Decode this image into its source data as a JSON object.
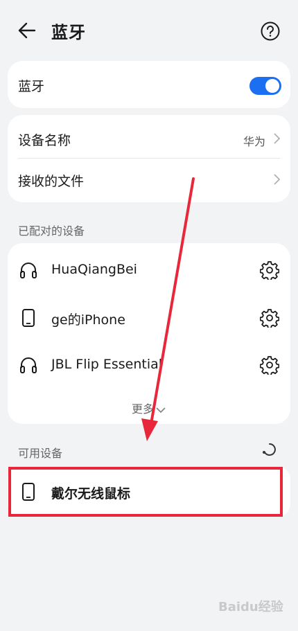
{
  "header": {
    "title": "蓝牙"
  },
  "bluetooth": {
    "label": "蓝牙",
    "enabled": true
  },
  "settings": {
    "device_name_label": "设备名称",
    "device_name_value": "华为",
    "received_files_label": "接收的文件"
  },
  "paired": {
    "section_label": "已配对的设备",
    "devices": [
      {
        "name": "HuaQiangBei",
        "icon": "headphones-icon"
      },
      {
        "name": "ge的iPhone",
        "icon": "phone-icon"
      },
      {
        "name": "JBL Flip Essential",
        "icon": "headphones-icon"
      }
    ],
    "more_label": "更多"
  },
  "available": {
    "section_label": "可用设备",
    "devices": [
      {
        "name": "戴尔无线鼠标",
        "icon": "phone-icon"
      }
    ]
  },
  "colors": {
    "accent": "#1d6ff2",
    "annotation": "#e8283a",
    "background": "#f1f3f5"
  },
  "watermark": "Baidu经验"
}
